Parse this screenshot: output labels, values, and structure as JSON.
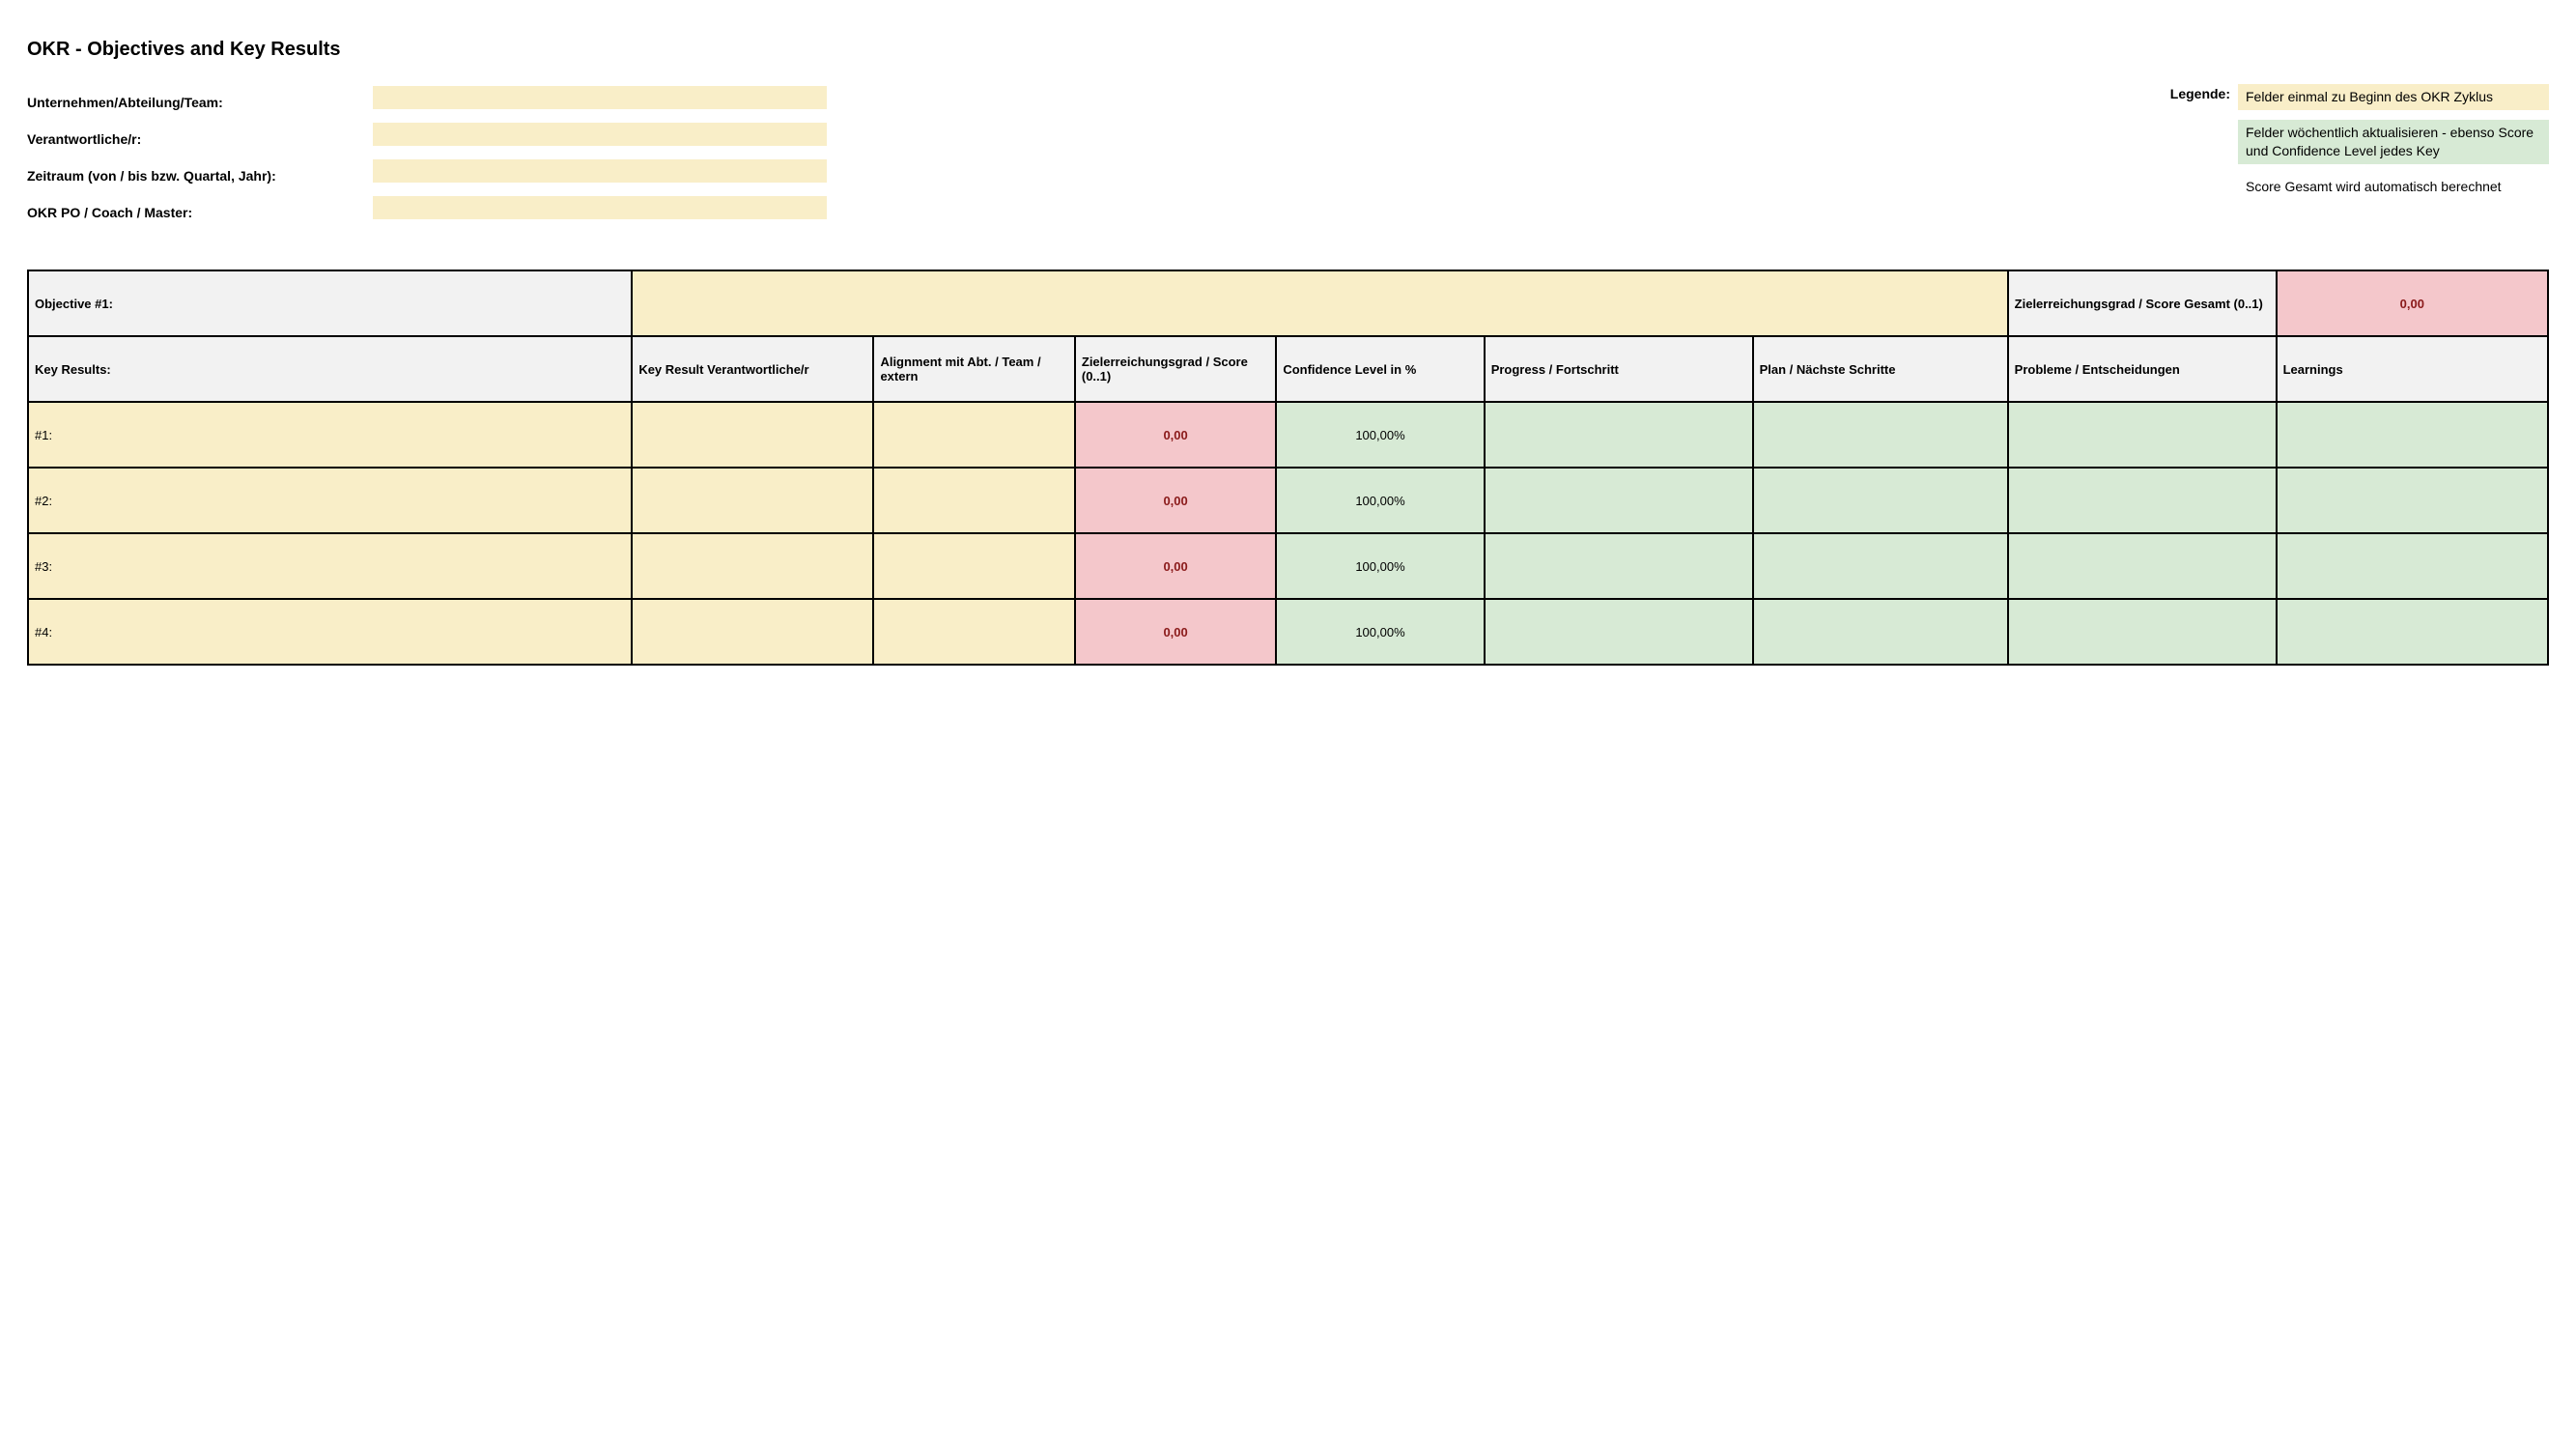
{
  "title": "OKR - Objectives and Key Results",
  "header": {
    "org_label": "Unternehmen/Abteilung/Team:",
    "org_value": "",
    "owner_label": "Verantwortliche/r:",
    "owner_value": "",
    "period_label": "Zeitraum (von / bis bzw. Quartal, Jahr):",
    "period_value": "",
    "coach_label": "OKR PO / Coach / Master:",
    "coach_value": ""
  },
  "legend": {
    "label": "Legende:",
    "yellow_text": "Felder einmal zu Beginn des OKR Zyklus",
    "green_text": "Felder wöchentlich aktualisieren - ebenso Score und Confidence Level jedes Key",
    "white_text": "Score Gesamt wird automatisch berechnet"
  },
  "table": {
    "objective_label": "Objective #1:",
    "objective_value": "",
    "total_score_label": "Zielerreichungsgrad / Score Gesamt (0..1)",
    "total_score_value": "0,00",
    "headers": {
      "kr": "Key Results:",
      "kr_owner": "Key Result Verantwortliche/r",
      "alignment": "Alignment mit Abt. / Team / extern",
      "score": "Zielerreichungsgrad / Score (0..1)",
      "confidence": "Confidence Level in %",
      "progress": "Progress / Fortschritt",
      "plan": "Plan / Nächste Schritte",
      "problems": "Probleme / Entscheidungen",
      "learnings": "Learnings"
    },
    "rows": [
      {
        "label": "#1:",
        "owner": "",
        "alignment": "",
        "score": "0,00",
        "confidence": "100,00%",
        "progress": "",
        "plan": "",
        "problems": "",
        "learnings": ""
      },
      {
        "label": "#2:",
        "owner": "",
        "alignment": "",
        "score": "0,00",
        "confidence": "100,00%",
        "progress": "",
        "plan": "",
        "problems": "",
        "learnings": ""
      },
      {
        "label": "#3:",
        "owner": "",
        "alignment": "",
        "score": "0,00",
        "confidence": "100,00%",
        "progress": "",
        "plan": "",
        "problems": "",
        "learnings": ""
      },
      {
        "label": "#4:",
        "owner": "",
        "alignment": "",
        "score": "0,00",
        "confidence": "100,00%",
        "progress": "",
        "plan": "",
        "problems": "",
        "learnings": ""
      }
    ]
  }
}
